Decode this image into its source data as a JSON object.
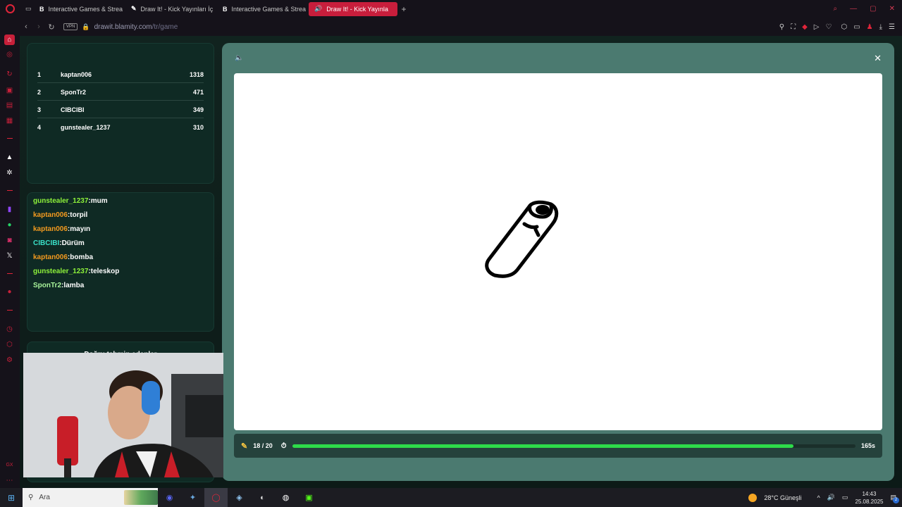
{
  "tabs": [
    {
      "icon": "B",
      "title": "Interactive Games & Strea",
      "active": false
    },
    {
      "icon": "✎",
      "title": "Draw It! - Kick Yayınları İç",
      "active": false
    },
    {
      "icon": "B",
      "title": "Interactive Games & Strea",
      "active": false
    },
    {
      "icon": "🔊",
      "title": "Draw It! - Kick Yayınla",
      "active": true
    }
  ],
  "address": {
    "vpn_label": "VPN",
    "host": "drawit.blamity.com",
    "path": "/tr/game"
  },
  "leaderboard": [
    {
      "rank": "1",
      "name": "kaptan006",
      "score": "1318"
    },
    {
      "rank": "2",
      "name": "SponTr2",
      "score": "471"
    },
    {
      "rank": "3",
      "name": "CIBCIBI",
      "score": "349"
    },
    {
      "rank": "4",
      "name": "gunstealer_1237",
      "score": "310"
    }
  ],
  "chat": [
    {
      "user": "gunstealer_1237",
      "text": "mum",
      "color": "#8ef23a"
    },
    {
      "user": "kaptan006",
      "text": "torpil",
      "color": "#f29a1f"
    },
    {
      "user": "kaptan006",
      "text": "mayın",
      "color": "#f29a1f"
    },
    {
      "user": "CIBCIBI",
      "text": "Dürüm",
      "color": "#3ae0c8"
    },
    {
      "user": "kaptan006",
      "text": "bomba",
      "color": "#f29a1f"
    },
    {
      "user": "gunstealer_1237",
      "text": "teleskop",
      "color": "#8ef23a"
    },
    {
      "user": "SponTr2",
      "text": "lamba",
      "color": "#a7f29a"
    }
  ],
  "lower_panel": {
    "title": "Doğru tahmin edenler"
  },
  "game": {
    "round": "18 / 20",
    "time_left": "165s",
    "time_fraction": 0.89
  },
  "taskbar": {
    "search_placeholder": "Ara",
    "weather": "28°C  Güneşli",
    "time": "14:43",
    "date": "25.08.2025",
    "notifications": "2"
  },
  "colors": {
    "accent": "#c8203a",
    "progress": "#2edc4a",
    "modal_bg": "#4b7a70"
  }
}
